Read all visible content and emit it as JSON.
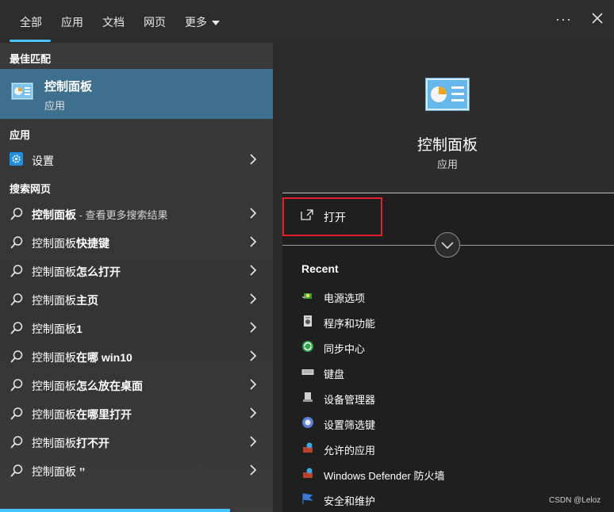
{
  "tabs": {
    "all": "全部",
    "apps": "应用",
    "docs": "文档",
    "web": "网页",
    "more": "更多"
  },
  "more_options_glyph": "···",
  "left": {
    "best_match_heading": "最佳匹配",
    "best_match": {
      "title": "控制面板",
      "subtitle": "应用"
    },
    "apps_heading": "应用",
    "settings_label": "设置",
    "web_heading": "搜索网页",
    "web_results": [
      {
        "bold": "控制面板",
        "hint": " - 查看更多搜索结果"
      },
      {
        "normal": "控制面板",
        "bold": "快捷键"
      },
      {
        "normal": "控制面板",
        "bold": "怎么打开"
      },
      {
        "normal": "控制面板",
        "bold": "主页"
      },
      {
        "normal": "控制面板",
        "bold": "1"
      },
      {
        "normal": "控制面板",
        "bold": "在哪 win10"
      },
      {
        "normal": "控制面板",
        "bold": "怎么放在桌面"
      },
      {
        "normal": "控制面板",
        "bold": "在哪里打开"
      },
      {
        "normal": "控制面板",
        "bold": "打不开"
      },
      {
        "normal": "控制面板",
        "bold": " ’’"
      }
    ]
  },
  "right": {
    "title": "控制面板",
    "subtitle": "应用",
    "open_label": "打开",
    "recent_heading": "Recent",
    "recent": [
      "电源选项",
      "程序和功能",
      "同步中心",
      "键盘",
      "设备管理器",
      "设置筛选键",
      "允许的应用",
      "Windows Defender 防火墙",
      "安全和维护"
    ]
  },
  "watermark": "CSDN @Leloz",
  "colors": {
    "accent": "#4cc2ff",
    "selected_row": "#3e6f8f",
    "highlight_box": "#e5202e"
  }
}
